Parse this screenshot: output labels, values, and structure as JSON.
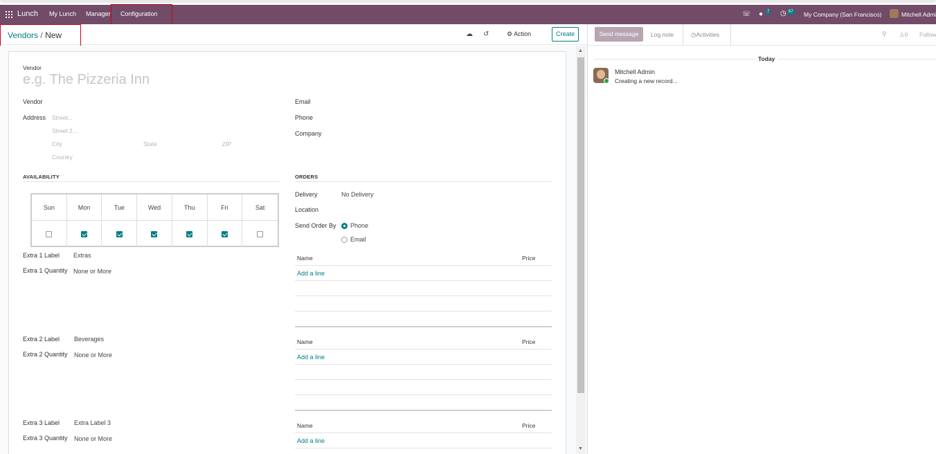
{
  "navbar": {
    "brand": "Lunch",
    "menu": [
      "My Lunch",
      "Manager",
      "Configuration"
    ],
    "messages_count": "7",
    "activities_count": "67",
    "company": "My Company (San Francisco)",
    "user": "Mitchell Admin"
  },
  "control": {
    "breadcrumb_parent": "Vendors",
    "breadcrumb_sep": "/",
    "breadcrumb_current": "New",
    "action_label": "Action",
    "create_label": "Create"
  },
  "form": {
    "vendor_label": "Vendor",
    "vendor_placeholder": "e.g. The Pizzeria Inn",
    "vendor2_label": "Vendor",
    "address_label": "Address",
    "street_ph": "Street...",
    "street2_ph": "Street 2...",
    "city_ph": "City",
    "state_ph": "State",
    "zip_ph": "ZIP",
    "country_ph": "Country",
    "email_label": "Email",
    "phone_label": "Phone",
    "company_label": "Company",
    "availability_title": "AVAILABILITY",
    "orders_title": "ORDERS",
    "days": [
      "Sun",
      "Mon",
      "Tue",
      "Wed",
      "Thu",
      "Fri",
      "Sat"
    ],
    "days_checked": [
      false,
      true,
      true,
      true,
      true,
      true,
      false
    ],
    "delivery_label": "Delivery",
    "delivery_value": "No Delivery",
    "location_label": "Location",
    "send_order_label": "Send Order By",
    "send_options": [
      "Phone",
      "Email"
    ],
    "send_selected": "Phone",
    "extra1_label": "Extra 1 Label",
    "extra1_value": "Extras",
    "extra1_qty_label": "Extra 1 Quantity",
    "extra1_qty_value": "None or More",
    "extra2_label": "Extra 2 Label",
    "extra2_value": "Beverages",
    "extra2_qty_label": "Extra 2 Quantity",
    "extra2_qty_value": "None or More",
    "extra3_label": "Extra 3 Label",
    "extra3_value": "Extra Label 3",
    "extra3_qty_label": "Extra 3 Quantity",
    "extra3_qty_value": "None or More",
    "table_name_header": "Name",
    "table_price_header": "Price",
    "add_line": "Add a line"
  },
  "chatter": {
    "send_message": "Send message",
    "log_note": "Log note",
    "activities": "Activities",
    "followers_count": "0",
    "follow": "Follow",
    "today": "Today",
    "author": "Mitchell Admin",
    "body": "Creating a new record..."
  }
}
